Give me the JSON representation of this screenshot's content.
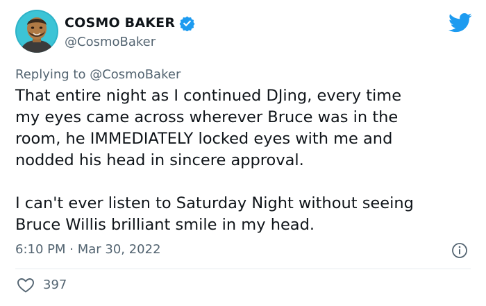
{
  "author": {
    "name": "COSMO BAKER",
    "handle": "@CosmoBaker",
    "verified": true
  },
  "reply_context": {
    "prefix": "Replying to ",
    "mention": "@CosmoBaker"
  },
  "tweet": {
    "paragraphs": [
      "That entire night as I continued DJing, every time\nmy eyes came across wherever Bruce was in the\nroom, he IMMEDIATELY locked eyes with me and\nnodded his head in sincere approval.",
      "I can't ever listen to Saturday Night without seeing\nBruce Willis brilliant smile in my head."
    ],
    "timestamp": "6:10 PM · Mar 30, 2022"
  },
  "engagement": {
    "likes": "397"
  },
  "icons": {
    "verified": "verified-badge-icon",
    "brand": "twitter-bird-icon",
    "info": "info-icon",
    "like": "heart-icon"
  },
  "colors": {
    "brand": "#1d9bf0",
    "text": "#0f1419",
    "secondary": "#536471",
    "divider": "#e6ecf0",
    "avatar_background": "#2fb3c8"
  }
}
